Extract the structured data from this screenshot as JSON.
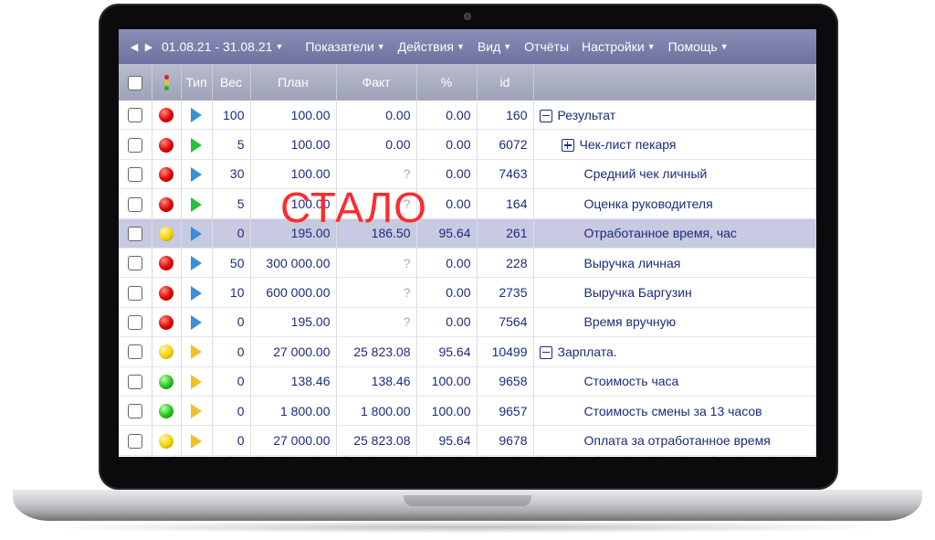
{
  "toolbar": {
    "date_range": "01.08.21 - 31.08.21",
    "menus": [
      "Показатели",
      "Действия",
      "Вид",
      "Отчёты",
      "Настройки",
      "Помощь"
    ]
  },
  "columns": {
    "type": "Тип",
    "weight": "Вес",
    "plan": "План",
    "fact": "Факт",
    "percent": "%",
    "id": "id"
  },
  "rows": [
    {
      "status": "red",
      "type": "blue",
      "weight": "100",
      "plan": "100.00",
      "fact": "0.00",
      "percent": "0.00",
      "id": "160",
      "name": "Результат",
      "tree": "minus",
      "level": 0
    },
    {
      "status": "red",
      "type": "green",
      "weight": "5",
      "plan": "100.00",
      "fact": "0.00",
      "percent": "0.00",
      "id": "6072",
      "name": "Чек-лист пекаря",
      "tree": "plus",
      "level": 1
    },
    {
      "status": "red",
      "type": "blue",
      "weight": "30",
      "plan": "100.00",
      "fact": "?",
      "percent": "0.00",
      "id": "7463",
      "name": "Средний чек личный",
      "tree": "",
      "level": 2
    },
    {
      "status": "red",
      "type": "green",
      "weight": "5",
      "plan": "100.00",
      "fact": "?",
      "percent": "0.00",
      "id": "164",
      "name": "Оценка руководителя",
      "tree": "",
      "level": 2
    },
    {
      "status": "yellow",
      "type": "blue",
      "weight": "0",
      "plan": "195.00",
      "fact": "186.50",
      "percent": "95.64",
      "id": "261",
      "name": "Отработанное время, час",
      "tree": "",
      "level": 2,
      "highlight": true
    },
    {
      "status": "red",
      "type": "blue",
      "weight": "50",
      "plan": "300 000.00",
      "fact": "?",
      "percent": "0.00",
      "id": "228",
      "name": "Выручка личная",
      "tree": "",
      "level": 2
    },
    {
      "status": "red",
      "type": "blue",
      "weight": "10",
      "plan": "600 000.00",
      "fact": "?",
      "percent": "0.00",
      "id": "2735",
      "name": "Выручка Баргузин",
      "tree": "",
      "level": 2
    },
    {
      "status": "red",
      "type": "blue",
      "weight": "0",
      "plan": "195.00",
      "fact": "?",
      "percent": "0.00",
      "id": "7564",
      "name": "Время вручную",
      "tree": "",
      "level": 2
    },
    {
      "status": "yellow",
      "type": "yellow",
      "weight": "0",
      "plan": "27 000.00",
      "fact": "25 823.08",
      "percent": "95.64",
      "id": "10499",
      "name": "Зарплата.",
      "tree": "minus",
      "level": 0
    },
    {
      "status": "green",
      "type": "yellow",
      "weight": "0",
      "plan": "138.46",
      "fact": "138.46",
      "percent": "100.00",
      "id": "9658",
      "name": "Стоимость часа",
      "tree": "",
      "level": 2
    },
    {
      "status": "green",
      "type": "yellow",
      "weight": "0",
      "plan": "1 800.00",
      "fact": "1 800.00",
      "percent": "100.00",
      "id": "9657",
      "name": "Стоимость смены за 13 часов",
      "tree": "",
      "level": 2
    },
    {
      "status": "yellow",
      "type": "yellow",
      "weight": "0",
      "plan": "27 000.00",
      "fact": "25 823.08",
      "percent": "95.64",
      "id": "9678",
      "name": "Оплата за отработанное время",
      "tree": "",
      "level": 2
    }
  ],
  "overlay_text": "СТАЛО"
}
